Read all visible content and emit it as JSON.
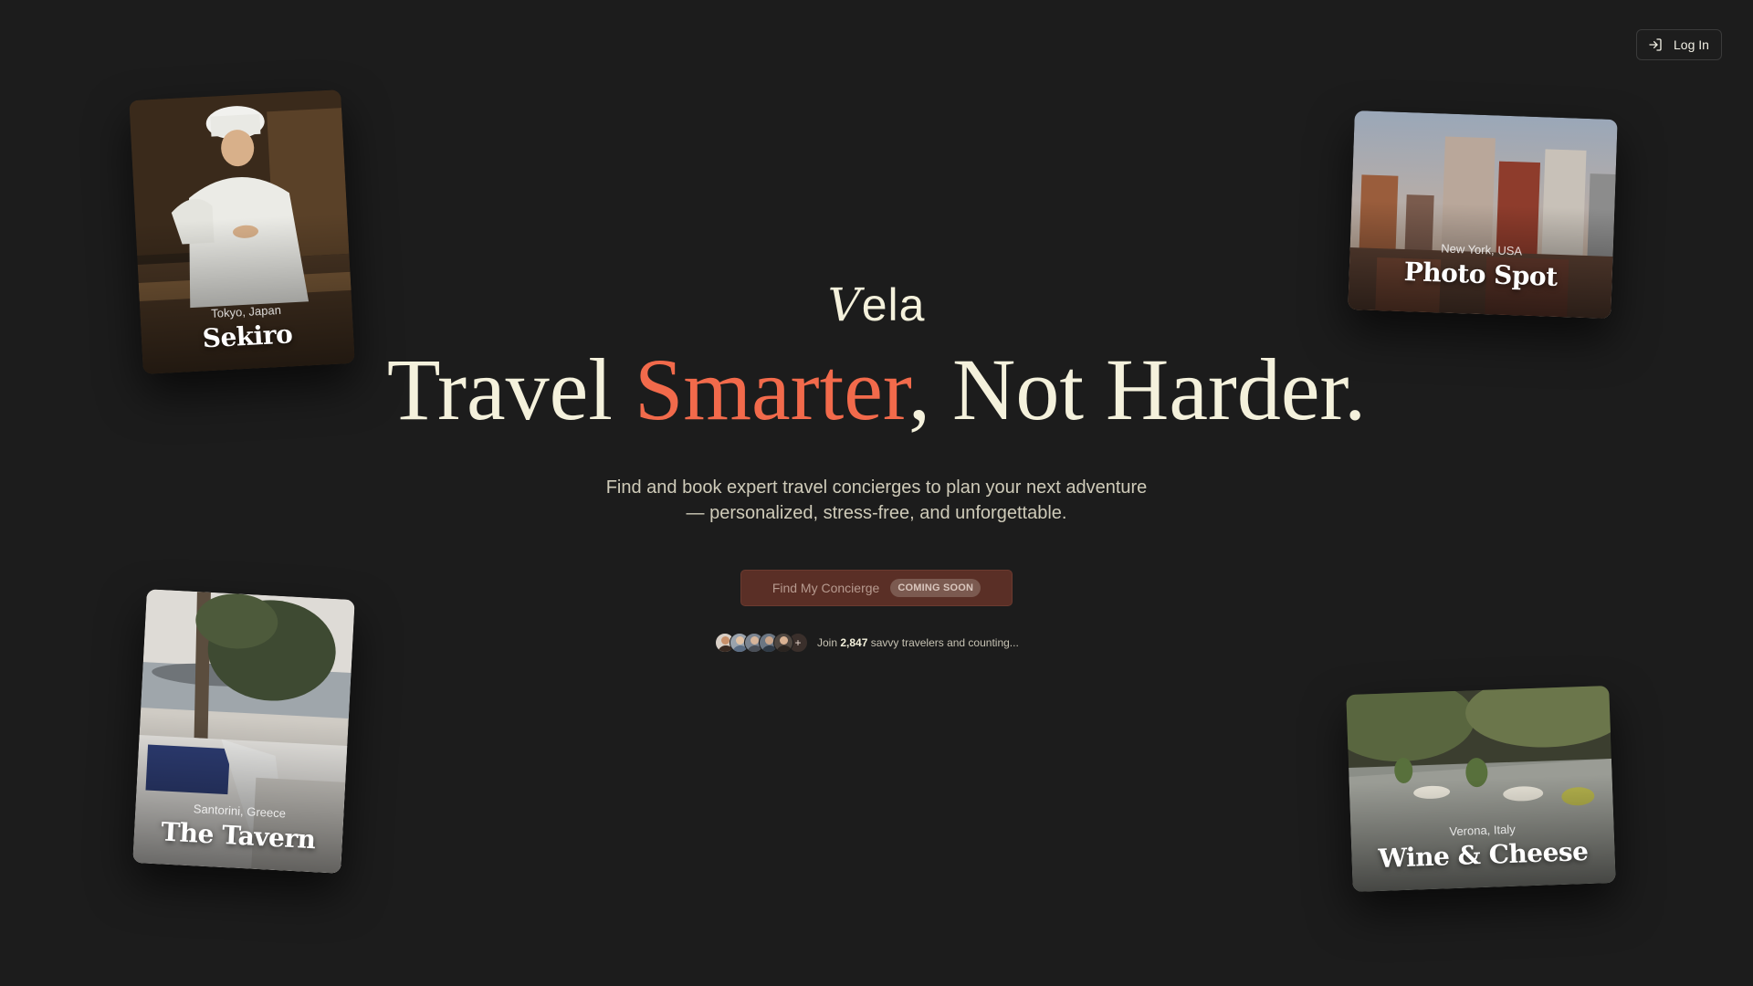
{
  "header": {
    "login_label": "Log In",
    "login_icon": "log-in-icon"
  },
  "brand": {
    "logo_text": "ela",
    "logo_initial": "V"
  },
  "hero": {
    "headline_before": "Travel ",
    "headline_accent": "Smarter",
    "headline_after": ", Not Harder.",
    "subtitle_line1": "Find and book expert travel concierges to plan your next adventure",
    "subtitle_line2": "— personalized, stress-free, and unforgettable.",
    "cta_label": "Find My Concierge",
    "cta_badge": "COMING SOON",
    "social_prefix": "Join ",
    "social_count": "2,847",
    "social_suffix": " savvy travelers and counting...",
    "avatar_more": "+"
  },
  "cards": {
    "sekiro": {
      "location": "Tokyo, Japan",
      "name": "Sekiro"
    },
    "photo": {
      "location": "New York, USA",
      "name": "Photo Spot"
    },
    "tavern": {
      "location": "Santorini, Greece",
      "name": "The Tavern"
    },
    "wine": {
      "location": "Verona, Italy",
      "name": "Wine & Cheese"
    }
  },
  "colors": {
    "background": "#1c1c1c",
    "accent": "#f26a4b",
    "text": "#f4f1dc",
    "cta_bg": "#5a2f26"
  }
}
